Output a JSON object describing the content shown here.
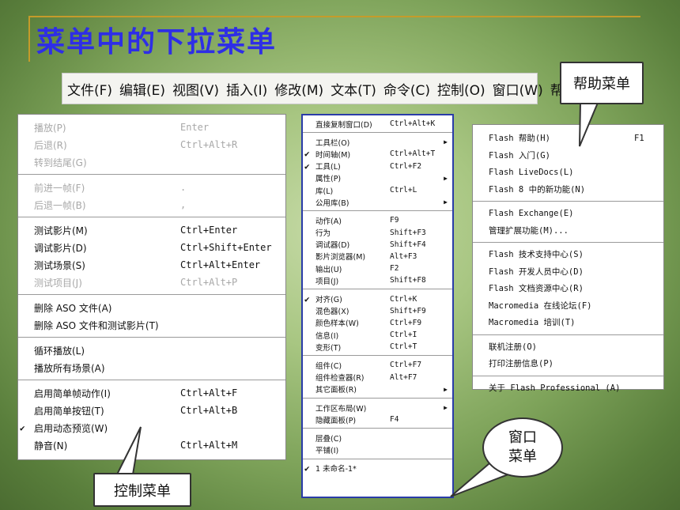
{
  "slide": {
    "title": "菜单中的下拉菜单"
  },
  "menubar": {
    "items": [
      "文件(F)",
      "编辑(E)",
      "视图(V)",
      "插入(I)",
      "修改(M)",
      "文本(T)",
      "命令(C)",
      "控制(O)",
      "窗口(W)",
      "帮助(H)"
    ]
  },
  "callouts": {
    "control": "控制菜单",
    "window_line1": "窗口",
    "window_line2": "菜单",
    "help": "帮助菜单"
  },
  "control_menu": {
    "items": [
      {
        "label": "播放(P)",
        "shortcut": "Enter",
        "disabled": true
      },
      {
        "label": "后退(R)",
        "shortcut": "Ctrl+Alt+R",
        "disabled": true
      },
      {
        "label": "转到结尾(G)",
        "shortcut": "",
        "disabled": true
      },
      {
        "sep": true
      },
      {
        "label": "前进一帧(F)",
        "shortcut": ".",
        "disabled": true
      },
      {
        "label": "后退一帧(B)",
        "shortcut": ",",
        "disabled": true
      },
      {
        "sep": true
      },
      {
        "label": "测试影片(M)",
        "shortcut": "Ctrl+Enter"
      },
      {
        "label": "调试影片(D)",
        "shortcut": "Ctrl+Shift+Enter"
      },
      {
        "label": "测试场景(S)",
        "shortcut": "Ctrl+Alt+Enter"
      },
      {
        "label": "测试项目(J)",
        "shortcut": "Ctrl+Alt+P",
        "disabled": true
      },
      {
        "sep": true
      },
      {
        "label": "删除 ASO 文件(A)",
        "shortcut": ""
      },
      {
        "label": "删除 ASO 文件和测试影片(T)",
        "shortcut": ""
      },
      {
        "sep": true
      },
      {
        "label": "循环播放(L)",
        "shortcut": ""
      },
      {
        "label": "播放所有场景(A)",
        "shortcut": ""
      },
      {
        "sep": true
      },
      {
        "label": "启用简单帧动作(I)",
        "shortcut": "Ctrl+Alt+F"
      },
      {
        "label": "启用简单按钮(T)",
        "shortcut": "Ctrl+Alt+B"
      },
      {
        "label": "启用动态预览(W)",
        "shortcut": "",
        "checked": true
      },
      {
        "label": "静音(N)",
        "shortcut": "Ctrl+Alt+M"
      }
    ]
  },
  "window_menu": {
    "items": [
      {
        "label": "直接复制窗口(D)",
        "shortcut": "Ctrl+Alt+K"
      },
      {
        "sep": true
      },
      {
        "label": "工具栏(O)",
        "shortcut": "",
        "submenu": true
      },
      {
        "label": "时间轴(M)",
        "shortcut": "Ctrl+Alt+T",
        "checked": true
      },
      {
        "label": "工具(L)",
        "shortcut": "Ctrl+F2",
        "checked": true
      },
      {
        "label": "属性(P)",
        "shortcut": "",
        "submenu": true
      },
      {
        "label": "库(L)",
        "shortcut": "Ctrl+L"
      },
      {
        "label": "公用库(B)",
        "shortcut": "",
        "submenu": true
      },
      {
        "sep": true
      },
      {
        "label": "动作(A)",
        "shortcut": "F9"
      },
      {
        "label": "行为",
        "shortcut": "Shift+F3"
      },
      {
        "label": "调试器(D)",
        "shortcut": "Shift+F4"
      },
      {
        "label": "影片浏览器(M)",
        "shortcut": "Alt+F3"
      },
      {
        "label": "输出(U)",
        "shortcut": "F2"
      },
      {
        "label": "项目(J)",
        "shortcut": "Shift+F8"
      },
      {
        "sep": true
      },
      {
        "label": "对齐(G)",
        "shortcut": "Ctrl+K",
        "checked": true
      },
      {
        "label": "混色器(X)",
        "shortcut": "Shift+F9"
      },
      {
        "label": "颜色样本(W)",
        "shortcut": "Ctrl+F9"
      },
      {
        "label": "信息(I)",
        "shortcut": "Ctrl+I"
      },
      {
        "label": "变形(T)",
        "shortcut": "Ctrl+T"
      },
      {
        "sep": true
      },
      {
        "label": "组件(C)",
        "shortcut": "Ctrl+F7"
      },
      {
        "label": "组件检查器(R)",
        "shortcut": "Alt+F7"
      },
      {
        "label": "其它面板(R)",
        "shortcut": "",
        "submenu": true
      },
      {
        "sep": true
      },
      {
        "label": "工作区布局(W)",
        "shortcut": "",
        "submenu": true
      },
      {
        "label": "隐藏面板(P)",
        "shortcut": "F4"
      },
      {
        "sep": true
      },
      {
        "label": "层叠(C)",
        "shortcut": ""
      },
      {
        "label": "平铺(I)",
        "shortcut": ""
      },
      {
        "sep": true
      },
      {
        "label": "1 未命名-1*",
        "shortcut": "",
        "checked": true
      }
    ]
  },
  "help_menu": {
    "items": [
      {
        "label": "Flash 帮助(H)",
        "shortcut": "F1"
      },
      {
        "label": "Flash 入门(G)",
        "shortcut": ""
      },
      {
        "label": "Flash LiveDocs(L)",
        "shortcut": ""
      },
      {
        "label": "Flash 8 中的新功能(N)",
        "shortcut": ""
      },
      {
        "sep": true
      },
      {
        "label": "Flash Exchange(E)",
        "shortcut": ""
      },
      {
        "label": "管理扩展功能(M)...",
        "shortcut": ""
      },
      {
        "sep": true
      },
      {
        "label": "Flash 技术支持中心(S)",
        "shortcut": ""
      },
      {
        "label": "Flash 开发人员中心(D)",
        "shortcut": ""
      },
      {
        "label": "Flash 文档资源中心(R)",
        "shortcut": ""
      },
      {
        "label": "Macromedia 在线论坛(F)",
        "shortcut": ""
      },
      {
        "label": "Macromedia 培训(T)",
        "shortcut": ""
      },
      {
        "sep": true
      },
      {
        "label": "联机注册(O)",
        "shortcut": ""
      },
      {
        "label": "打印注册信息(P)",
        "shortcut": ""
      },
      {
        "sep": true
      },
      {
        "label": "关于 Flash Professional (A)",
        "shortcut": ""
      }
    ]
  }
}
